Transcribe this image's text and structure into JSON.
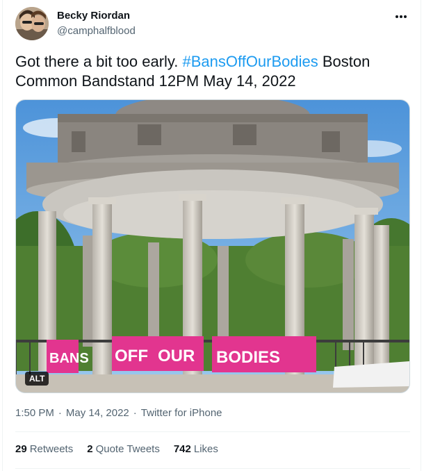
{
  "user": {
    "display_name": "Becky Riordan",
    "handle": "@camphalfblood"
  },
  "tweet": {
    "text_part1": "Got there a bit too early. ",
    "hashtag": "#BansOffOurBodies",
    "text_part2": " Boston Common Bandstand 12PM May 14, 2022"
  },
  "media": {
    "alt_label": "ALT",
    "banner_words": [
      "BANS",
      "OFF",
      "OUR",
      "BODIES"
    ]
  },
  "meta": {
    "time": "1:50 PM",
    "separator": "·",
    "date": "May 14, 2022",
    "source": "Twitter for iPhone"
  },
  "stats": {
    "retweets_count": "29",
    "retweets_label": "Retweets",
    "quotes_count": "2",
    "quotes_label": "Quote Tweets",
    "likes_count": "742",
    "likes_label": "Likes"
  },
  "icons": {
    "more": "more-dots-icon"
  },
  "colors": {
    "link": "#1d9bf0",
    "secondary_text": "#536471",
    "banner_pink": "#e2358f"
  }
}
